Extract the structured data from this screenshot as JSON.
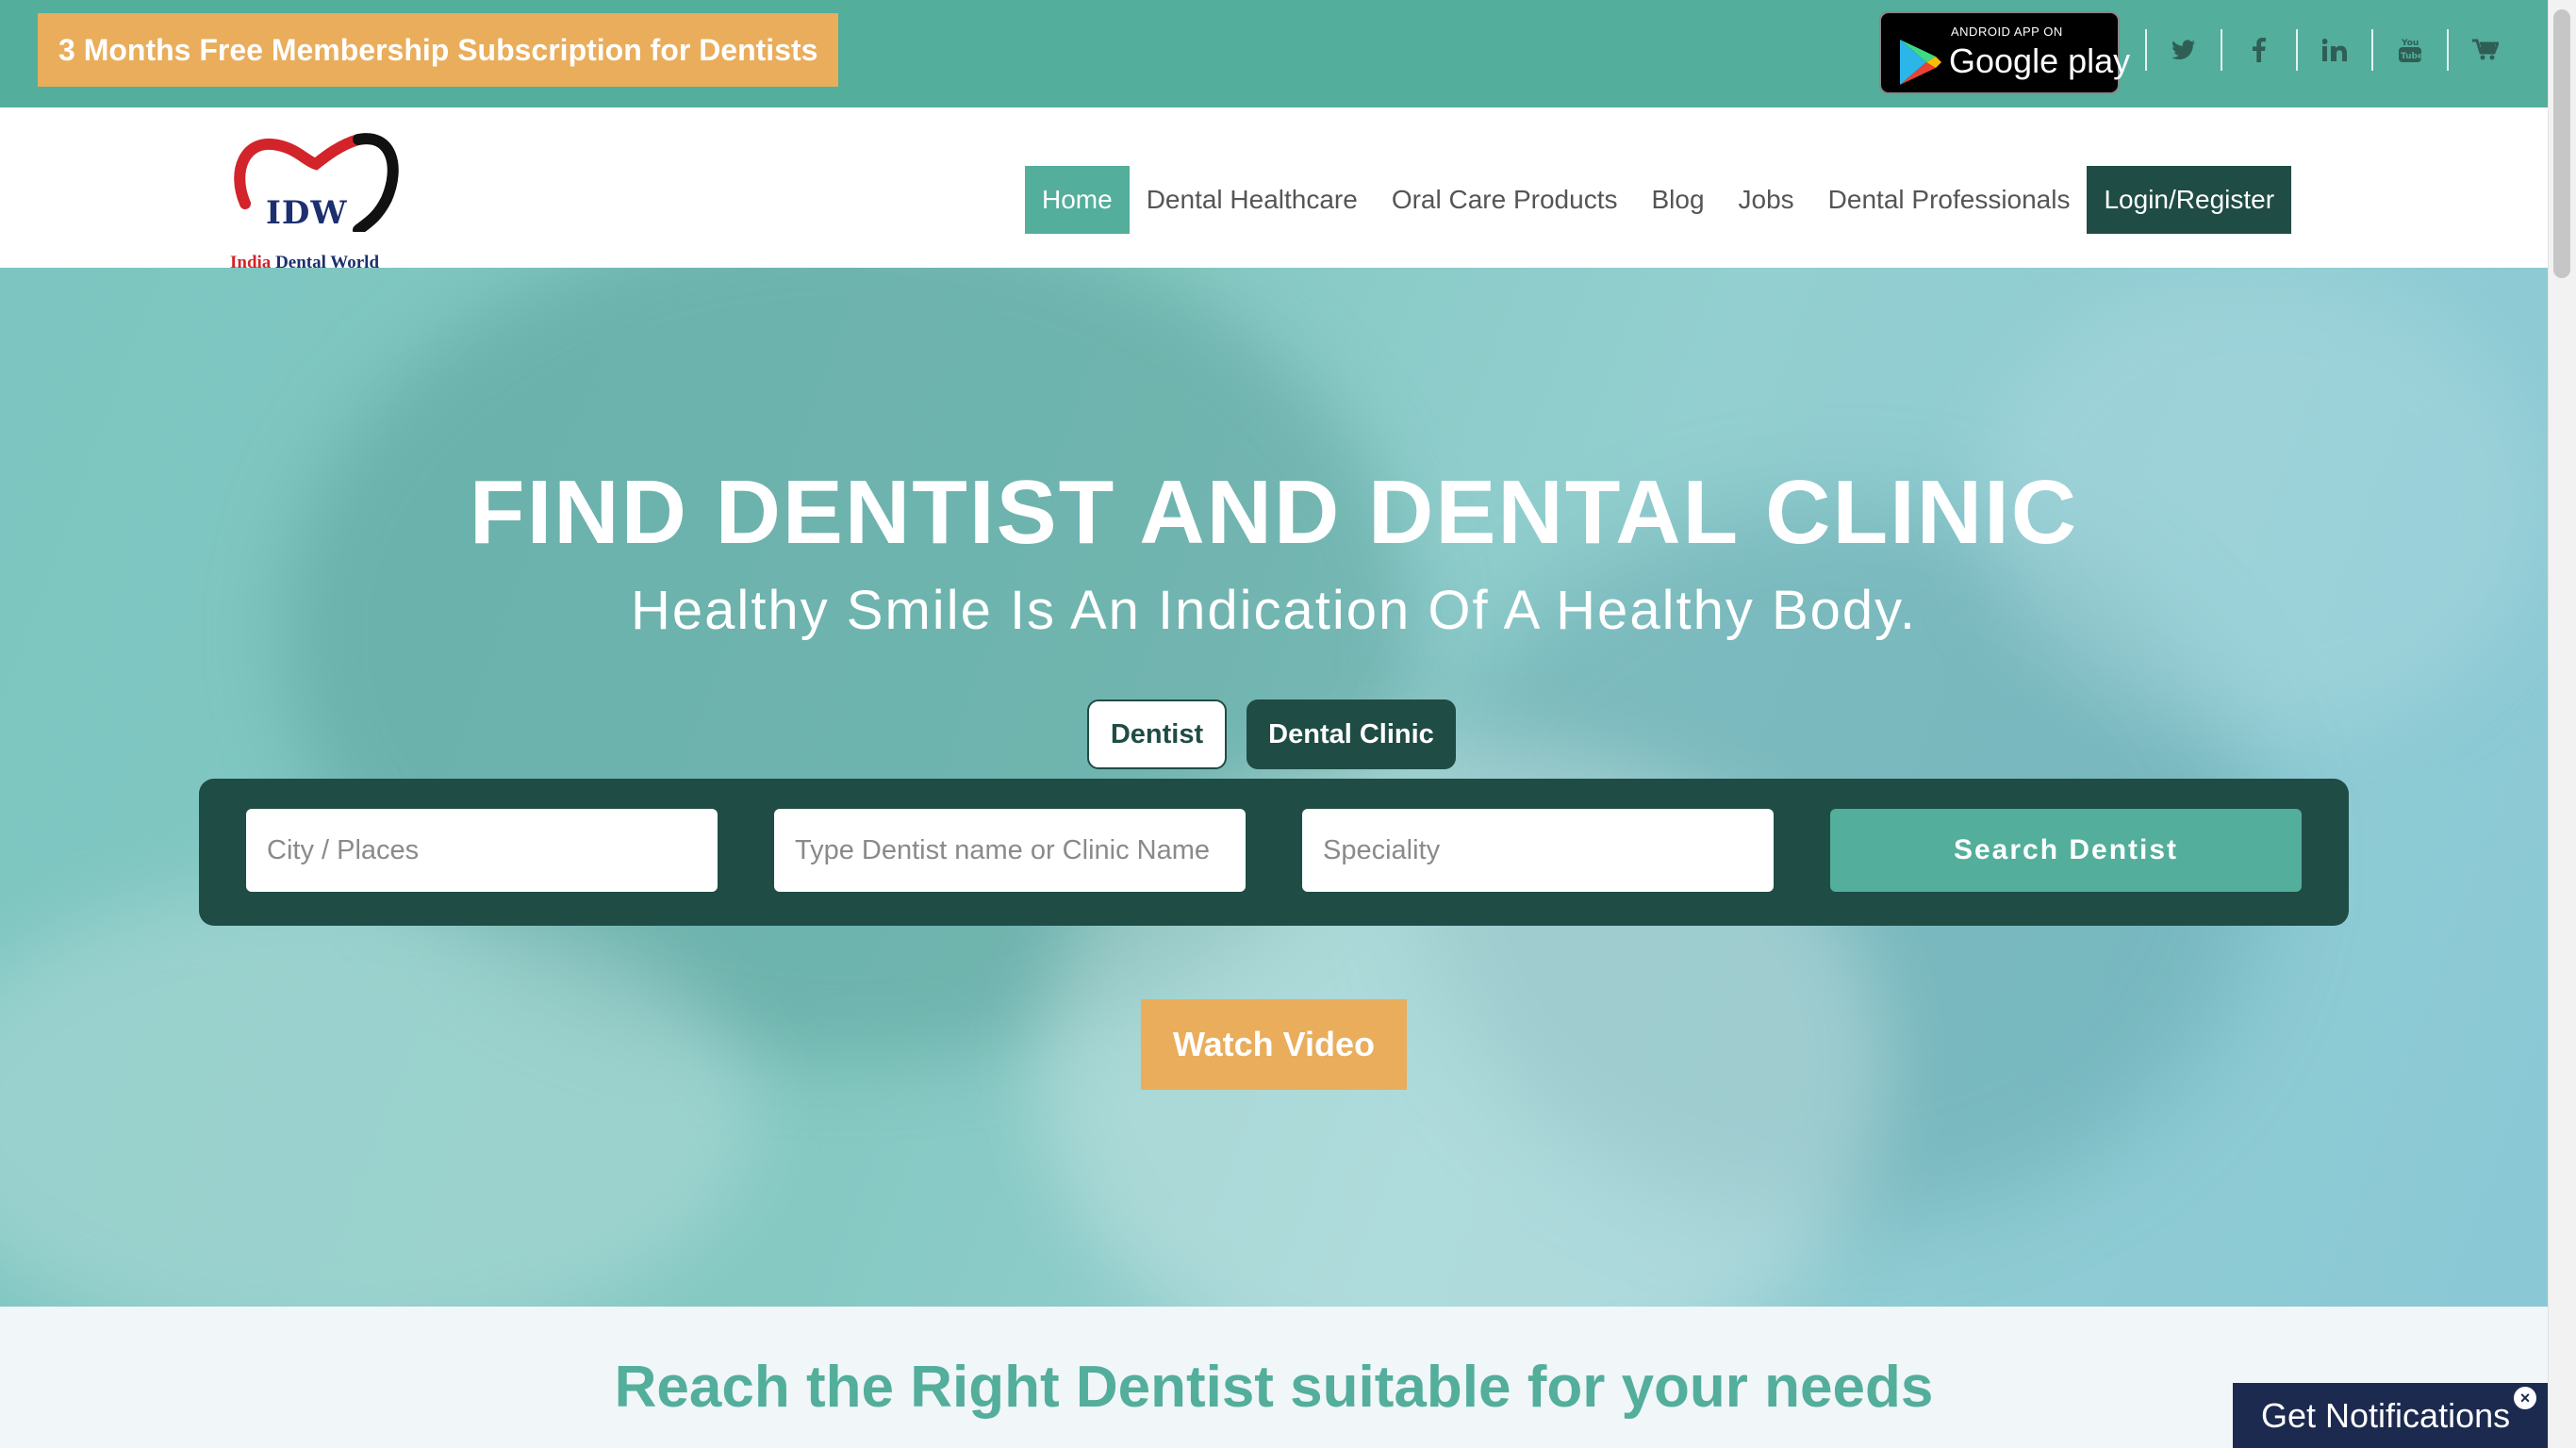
{
  "promo": {
    "label": "3 Months Free Membership Subscription for Dentists"
  },
  "google_play": {
    "small": "ANDROID APP ON",
    "big": "Google play"
  },
  "social": [
    {
      "icon": "twitter-icon",
      "glyph": "🐦"
    },
    {
      "icon": "facebook-icon",
      "glyph": "f"
    },
    {
      "icon": "linkedin-icon",
      "glyph": "in"
    },
    {
      "icon": "youtube-icon",
      "glyph": "▶"
    },
    {
      "icon": "cart-icon",
      "glyph": "🛒"
    }
  ],
  "logo": {
    "text": "IDW",
    "tag_red": "India",
    "tag_rest": " Dental World"
  },
  "nav": {
    "items": [
      {
        "label": "Home",
        "active": true
      },
      {
        "label": "Dental Healthcare"
      },
      {
        "label": "Oral Care Products"
      },
      {
        "label": "Blog"
      },
      {
        "label": "Jobs"
      },
      {
        "label": "Dental Professionals"
      },
      {
        "label": "Login/Register"
      }
    ]
  },
  "hero": {
    "title": "FIND DENTIST AND DENTAL CLINIC",
    "subtitle": "Healthy Smile Is An Indication Of A Healthy Body.",
    "toggle_dentist": "Dentist",
    "toggle_clinic": "Dental Clinic",
    "city_placeholder": "City / Places",
    "name_placeholder": "Type Dentist name or Clinic Name",
    "speciality_placeholder": "Speciality",
    "search_label": "Search Dentist",
    "watch_label": "Watch Video"
  },
  "section": {
    "title_pre": "Reach the ",
    "title_bold": "Right Dentist",
    "title_post": " suitable for your needs"
  },
  "notify": {
    "label": "Get Notifications",
    "close": "×"
  },
  "colors": {
    "teal": "#53ae9c",
    "dark_teal": "#1f4c44",
    "orange": "#e9ad5b",
    "navy": "#1c2a4f"
  }
}
